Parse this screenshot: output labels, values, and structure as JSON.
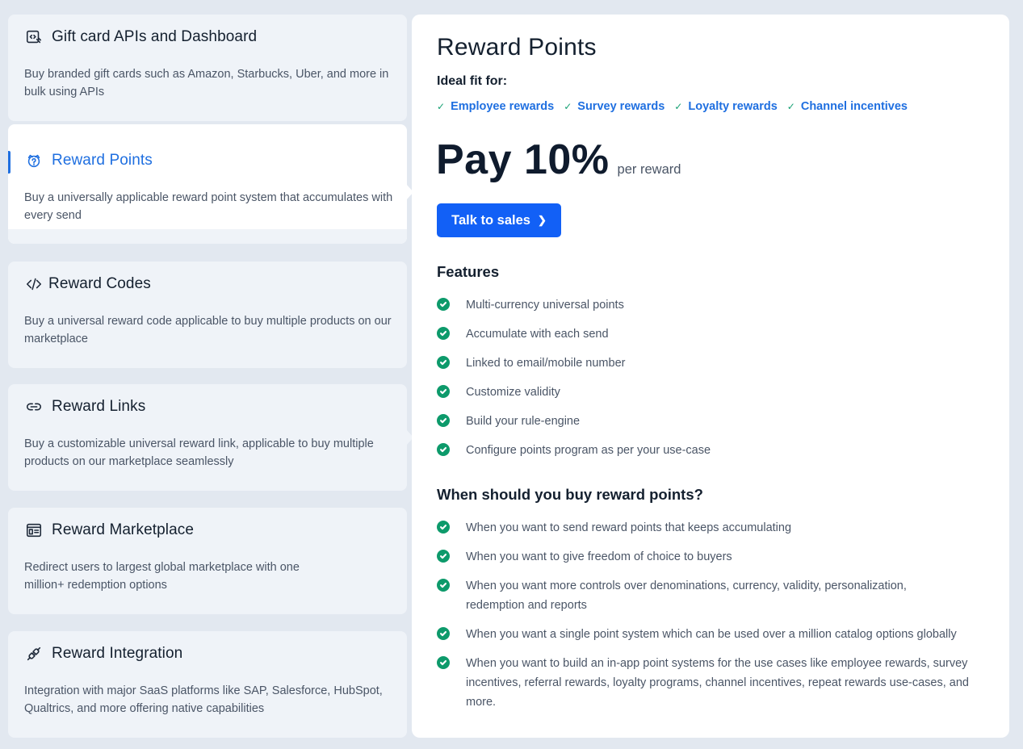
{
  "sidebar": {
    "items": [
      {
        "title": "Gift card APIs and Dashboard",
        "desc": "Buy branded gift cards such as Amazon, Starbucks, Uber, and more in bulk using APIs",
        "icon": "code-card-icon"
      },
      {
        "title": "Reward Points",
        "desc": "Buy a universally applicable reward point system that accumulates with every send",
        "icon": "reward-points-icon"
      },
      {
        "title": "Reward Codes",
        "desc": "Buy a universal reward code applicable to buy multiple products on our marketplace",
        "icon": "code-brackets-icon"
      },
      {
        "title": "Reward Links",
        "desc": "Buy a customizable universal reward link, applicable to buy multiple products on our marketplace seamlessly",
        "icon": "link-icon"
      },
      {
        "title": "Reward Marketplace",
        "desc": "Redirect users to largest global marketplace with one million+ redemption options",
        "icon": "marketplace-window-icon"
      },
      {
        "title": "Reward Integration",
        "desc": "Integration with major SaaS platforms like SAP, Salesforce, HubSpot, Qualtrics, and more offering native capabilities",
        "icon": "plug-icon"
      }
    ],
    "active_index": 1
  },
  "panel": {
    "title": "Reward Points",
    "ideal_label": "Ideal fit for:",
    "tags": [
      "Employee rewards",
      "Survey rewards",
      "Loyalty rewards",
      "Channel incentives"
    ],
    "price_big": "Pay 10%",
    "price_sub": "per reward",
    "cta_label": "Talk to sales",
    "features_title": "Features",
    "features": [
      "Multi-currency universal points",
      "Accumulate with each send",
      "Linked to email/mobile number",
      "Customize validity",
      "Build your rule-engine",
      "Configure points program as per your use-case"
    ],
    "when_title": "When should you buy reward points?",
    "when": [
      "When you want to send reward points that keeps accumulating",
      "When you want to give freedom of choice to buyers",
      "When you want more controls over denominations, currency, validity, personalization, redemption and reports",
      "When you want a single point system which can be used over a million catalog options globally",
      "When you want to build an in-app point systems for the use cases like employee rewards, survey incentives, referral rewards, loyalty programs, channel incentives, repeat rewards use-cases, and more."
    ]
  },
  "colors": {
    "accent": "#1f6fe0",
    "cta": "#1260f6",
    "check": "#0d9a6b",
    "page_bg": "#e2e8f0"
  }
}
